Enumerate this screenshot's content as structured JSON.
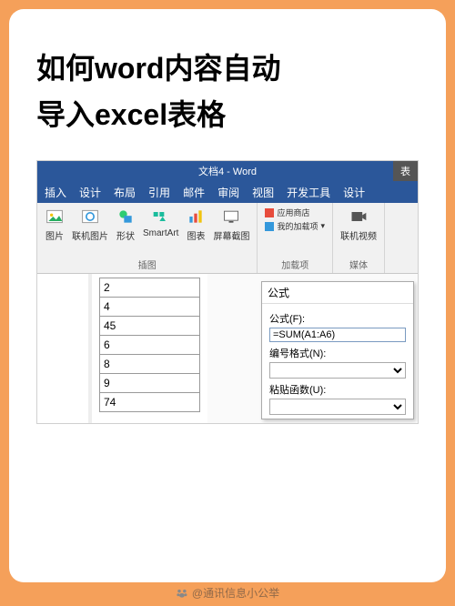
{
  "title_line1": "如何word内容自动",
  "title_line2": "导入excel表格",
  "word": {
    "windowTitle": "文档4 - Word",
    "rightTab": "表",
    "tabs": [
      "插入",
      "设计",
      "布局",
      "引用",
      "邮件",
      "审阅",
      "视图",
      "开发工具",
      "设计"
    ],
    "group_illustrations": {
      "items": [
        "图片",
        "联机图片",
        "形状",
        "SmartArt",
        "图表",
        "屏幕截图"
      ],
      "label": "插图"
    },
    "group_addins": {
      "store": "应用商店",
      "myAddins": "我的加载项",
      "label": "加载项"
    },
    "group_media": {
      "item": "联机视频",
      "label": "媒体"
    }
  },
  "tableValues": [
    "2",
    "4",
    "45",
    "6",
    "8",
    "9",
    "74"
  ],
  "dialog": {
    "title": "公式",
    "formulaLabel": "公式(F):",
    "formulaValue": "=SUM(A1:A6)",
    "numFormatLabel": "编号格式(N):",
    "pasteFuncLabel": "粘贴函数(U):"
  },
  "watermark": "@通讯信息小公举"
}
